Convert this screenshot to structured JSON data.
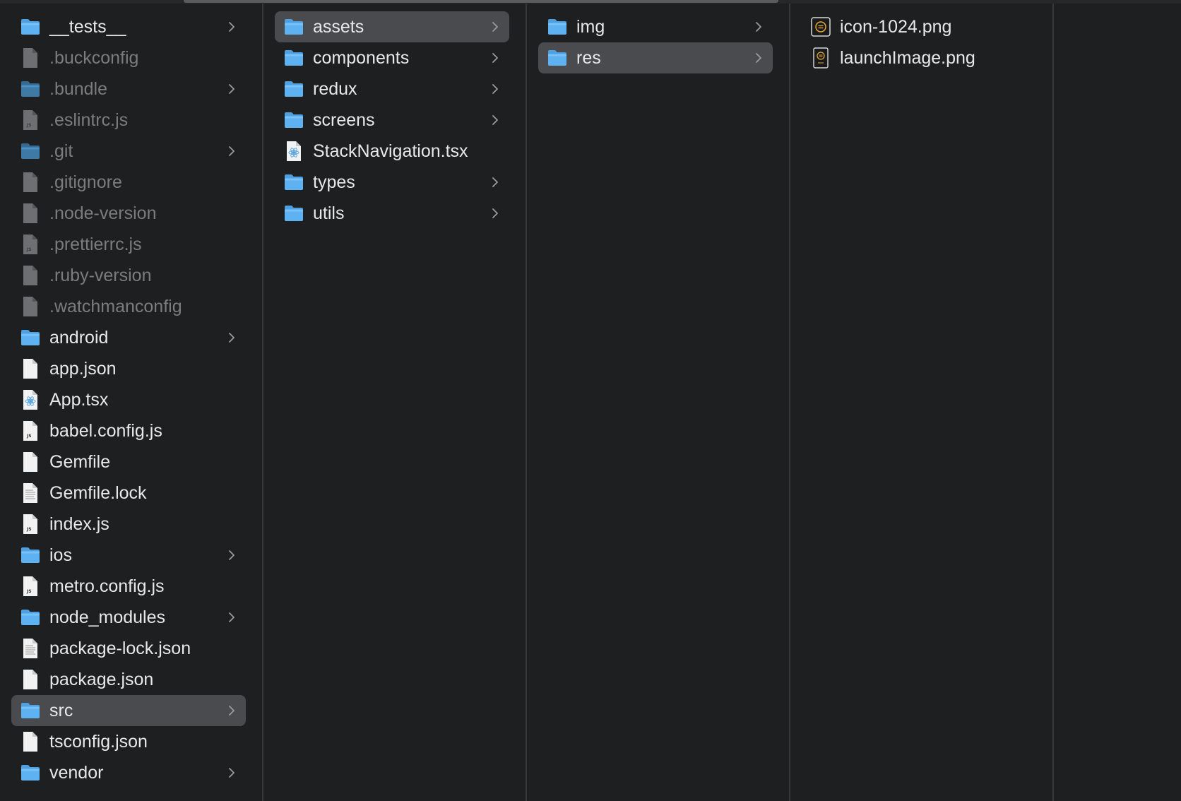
{
  "columns": [
    {
      "items": [
        {
          "label": "__tests__",
          "type": "folder",
          "has_children": true
        },
        {
          "label": ".buckconfig",
          "type": "file",
          "hidden": true
        },
        {
          "label": ".bundle",
          "type": "folder",
          "has_children": true,
          "hidden": true
        },
        {
          "label": ".eslintrc.js",
          "type": "js",
          "hidden": true
        },
        {
          "label": ".git",
          "type": "folder",
          "has_children": true,
          "hidden": true
        },
        {
          "label": ".gitignore",
          "type": "file",
          "hidden": true
        },
        {
          "label": ".node-version",
          "type": "file",
          "hidden": true
        },
        {
          "label": ".prettierrc.js",
          "type": "js",
          "hidden": true
        },
        {
          "label": ".ruby-version",
          "type": "file",
          "hidden": true
        },
        {
          "label": ".watchmanconfig",
          "type": "file",
          "hidden": true
        },
        {
          "label": "android",
          "type": "folder",
          "has_children": true
        },
        {
          "label": "app.json",
          "type": "file"
        },
        {
          "label": "App.tsx",
          "type": "tsx"
        },
        {
          "label": "babel.config.js",
          "type": "js"
        },
        {
          "label": "Gemfile",
          "type": "file"
        },
        {
          "label": "Gemfile.lock",
          "type": "text"
        },
        {
          "label": "index.js",
          "type": "js"
        },
        {
          "label": "ios",
          "type": "folder",
          "has_children": true
        },
        {
          "label": "metro.config.js",
          "type": "js"
        },
        {
          "label": "node_modules",
          "type": "folder",
          "has_children": true
        },
        {
          "label": "package-lock.json",
          "type": "text"
        },
        {
          "label": "package.json",
          "type": "file"
        },
        {
          "label": "src",
          "type": "folder",
          "has_children": true,
          "selected": true
        },
        {
          "label": "tsconfig.json",
          "type": "file"
        },
        {
          "label": "vendor",
          "type": "folder",
          "has_children": true
        }
      ]
    },
    {
      "items": [
        {
          "label": "assets",
          "type": "folder",
          "has_children": true,
          "selected": true
        },
        {
          "label": "components",
          "type": "folder",
          "has_children": true
        },
        {
          "label": "redux",
          "type": "folder",
          "has_children": true
        },
        {
          "label": "screens",
          "type": "folder",
          "has_children": true
        },
        {
          "label": "StackNavigation.tsx",
          "type": "tsx"
        },
        {
          "label": "types",
          "type": "folder",
          "has_children": true
        },
        {
          "label": "utils",
          "type": "folder",
          "has_children": true
        }
      ]
    },
    {
      "items": [
        {
          "label": "img",
          "type": "folder",
          "has_children": true
        },
        {
          "label": "res",
          "type": "folder",
          "has_children": true,
          "selected": true
        }
      ]
    },
    {
      "items": [
        {
          "label": "icon-1024.png",
          "type": "image"
        },
        {
          "label": "launchImage.png",
          "type": "image-tall"
        }
      ]
    }
  ],
  "colors": {
    "background": "#1e1f21",
    "selection": "#4a4b4e",
    "folder": "#5fb2f2",
    "hidden_text": "#7b7c7e",
    "text": "#e8e8e8"
  }
}
